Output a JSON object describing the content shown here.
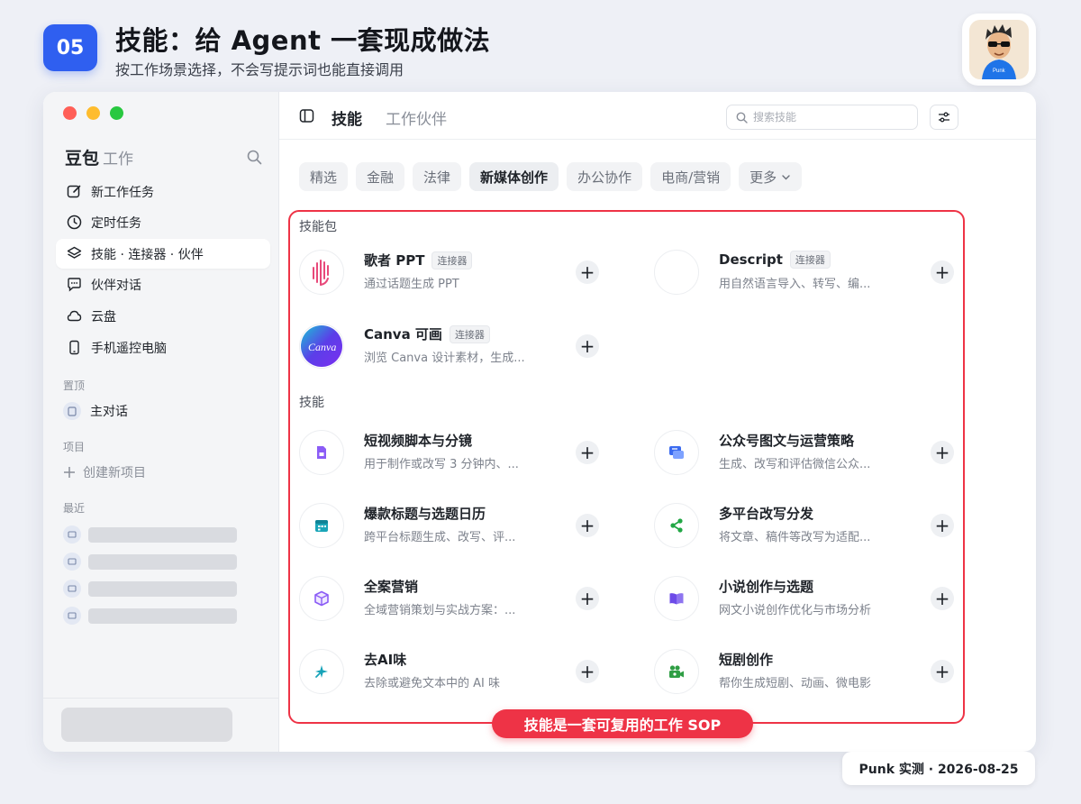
{
  "slide": {
    "number": "05",
    "title": "技能：给 Agent 一套现成做法",
    "subtitle": "按工作场景选择，不会写提示词也能直接调用",
    "avatar_text": "Punk"
  },
  "sidebar": {
    "brand": "豆包",
    "brand_sub": "工作",
    "nav": [
      {
        "label": "新工作任务",
        "icon": "edit-icon"
      },
      {
        "label": "定时任务",
        "icon": "clock-icon"
      },
      {
        "label": "技能 · 连接器 · 伙伴",
        "icon": "layers-icon",
        "active": true
      },
      {
        "label": "伙伴对话",
        "icon": "chat-icon"
      },
      {
        "label": "云盘",
        "icon": "cloud-icon"
      },
      {
        "label": "手机遥控电脑",
        "icon": "phone-icon"
      }
    ],
    "pinned_label": "置顶",
    "pinned_item": "主对话",
    "projects_label": "项目",
    "new_project": "创建新项目",
    "recent_label": "最近"
  },
  "topbar": {
    "tab_skill": "技能",
    "tab_partner": "工作伙伴",
    "search_placeholder": "搜索技能"
  },
  "categories": [
    "精选",
    "金融",
    "法律",
    "新媒体创作",
    "办公协作",
    "电商/营销",
    "更多"
  ],
  "active_category": "新媒体创作",
  "packs_label": "技能包",
  "packs": [
    {
      "name": "歌者 PPT",
      "tag": "连接器",
      "desc": "通过话题生成 PPT"
    },
    {
      "name": "Descript",
      "tag": "连接器",
      "desc": "用自然语言导入、转写、编..."
    },
    {
      "name": "Canva 可画",
      "tag": "连接器",
      "desc": "浏览 Canva 设计素材，生成..."
    }
  ],
  "skills_label": "技能",
  "skills": [
    {
      "name": "短视频脚本与分镜",
      "desc": "用于制作或改写 3 分钟内、..."
    },
    {
      "name": "公众号图文与运营策略",
      "desc": "生成、改写和评估微信公众..."
    },
    {
      "name": "爆款标题与选题日历",
      "desc": "跨平台标题生成、改写、评..."
    },
    {
      "name": "多平台改写分发",
      "desc": "将文章、稿件等改写为适配..."
    },
    {
      "name": "全案营销",
      "desc": "全域营销策划与实战方案：..."
    },
    {
      "name": "小说创作与选题",
      "desc": "网文小说创作优化与市场分析"
    },
    {
      "name": "去AI味",
      "desc": "去除或避免文本中的 AI 味"
    },
    {
      "name": "短剧创作",
      "desc": "帮你生成短剧、动画、微电影"
    }
  ],
  "add_symbol": "+",
  "callout": "技能是一套可复用的工作 SOP",
  "footer": "Punk 实测 · 2026-08-25",
  "colors": {
    "accent": "#2f5ff0",
    "highlight": "#ee3346"
  }
}
